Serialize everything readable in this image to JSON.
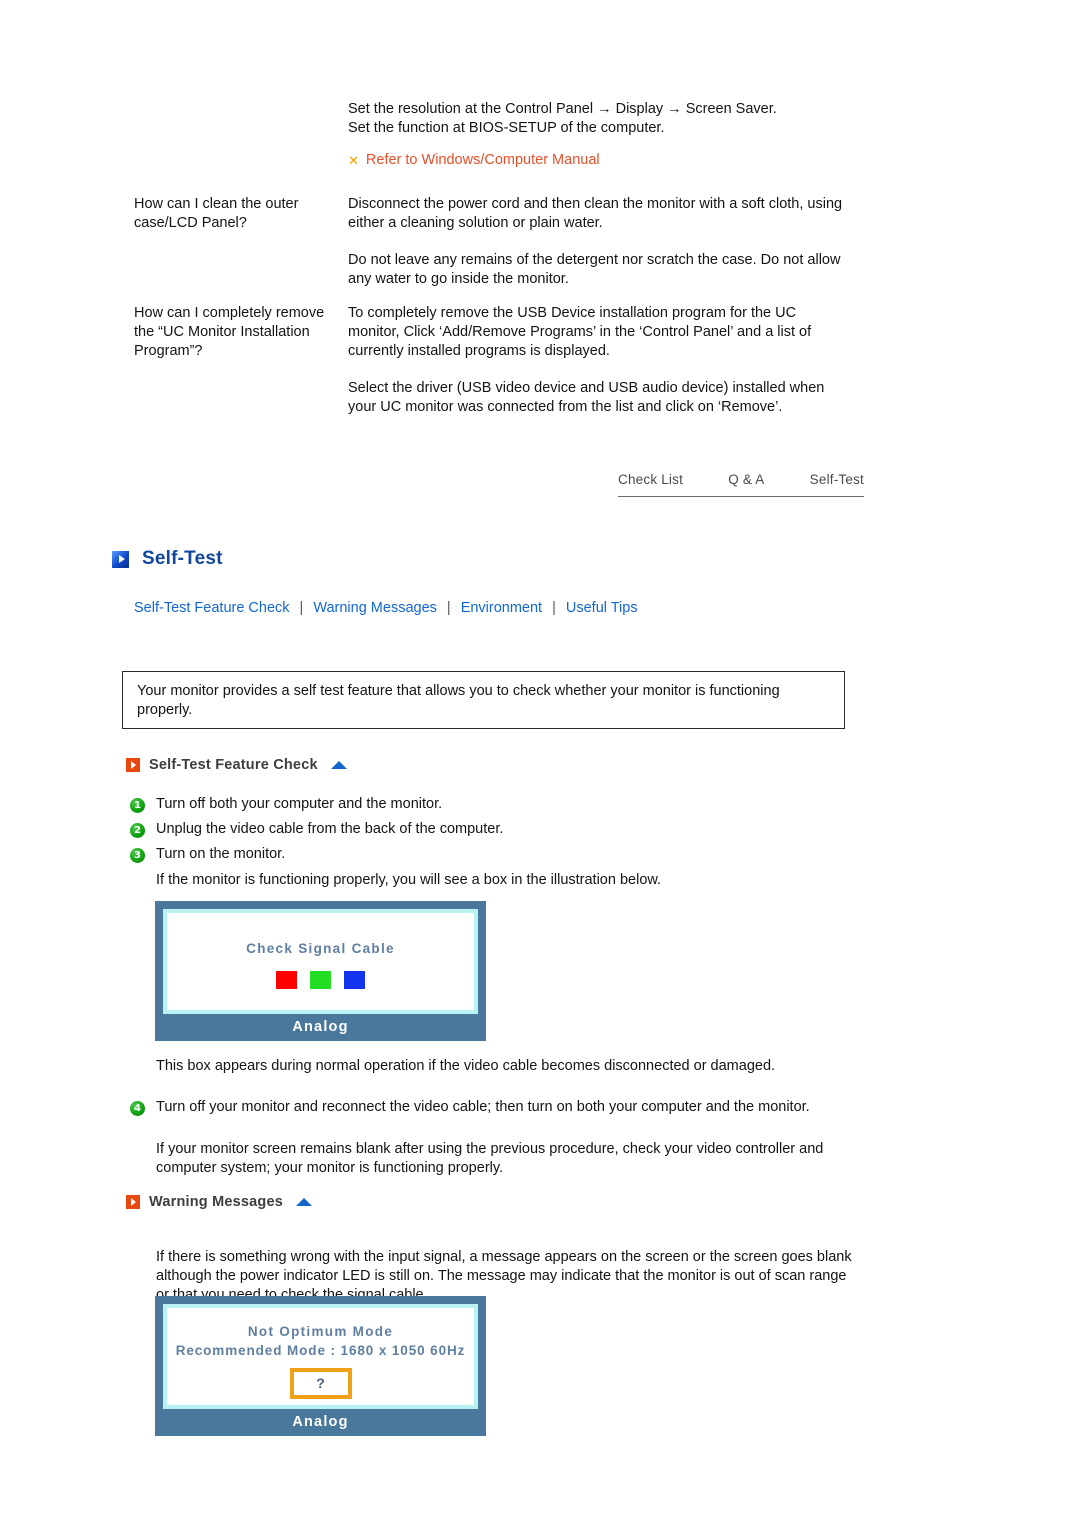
{
  "faq": {
    "intro_lines": [
      "Set the resolution at the Control Panel → Display → Screen Saver.",
      "Set the function at BIOS-SETUP of the computer."
    ],
    "refer_mark": "✕",
    "refer_text": "Refer to Windows/Computer Manual",
    "rows": [
      {
        "question": "How can I clean the outer case/LCD Panel?",
        "answers": [
          "Disconnect the power cord and then clean the monitor with a soft cloth, using either a cleaning solution or plain water.",
          "Do not leave any remains of the detergent nor scratch the case. Do not allow any water to go inside the monitor."
        ]
      },
      {
        "question": "How can I completely remove the “UC Monitor Installation Program”?",
        "answers": [
          "To completely remove the USB Device installation program for the UC monitor, Click ‘Add/Remove Programs’ in the ‘Control Panel’ and a list of currently installed programs is displayed.",
          "Select the driver (USB video device and USB audio device) installed when your UC monitor was connected from the list and click on ‘Remove’."
        ]
      }
    ]
  },
  "tabnav": {
    "tabs": [
      {
        "label": "Check List"
      },
      {
        "label": "Q & A"
      },
      {
        "label": "Self-Test"
      }
    ]
  },
  "section": {
    "title": "Self-Test",
    "icon": "blue-play-square-icon",
    "links": [
      {
        "label": "Self-Test Feature Check"
      },
      {
        "label": "Warning Messages"
      },
      {
        "label": "Environment"
      },
      {
        "label": "Useful Tips"
      }
    ],
    "link_separator": "|"
  },
  "intro_box": {
    "text": "Your monitor provides a self test feature that allows you to check whether your monitor is functioning properly."
  },
  "self_test_feature_check": {
    "heading": "Self-Test Feature Check",
    "steps": [
      {
        "num": "1",
        "text": "Turn off both your computer and the monitor."
      },
      {
        "num": "2",
        "text": "Unplug the video cable from the back of the computer."
      },
      {
        "num": "3",
        "text": "Turn on the monitor."
      }
    ],
    "note_after_steps": "If the monitor is functioning properly, you will see a box in the illustration below.",
    "caption_after_image": "This box appears during normal operation if the video cable becomes disconnected or damaged.",
    "step4": {
      "num": "4",
      "text": "Turn off your monitor and reconnect the video cable; then turn on both your computer and the monitor."
    },
    "closing_note": "If your monitor screen remains blank after using the previous procedure, check your video controller and computer system; your monitor is functioning properly."
  },
  "monitor_check_signal": {
    "osd_title": "Check Signal Cable",
    "analog_label": "Analog",
    "colors": [
      {
        "name": "red-swatch",
        "hex": "#ff0000"
      },
      {
        "name": "green-swatch",
        "hex": "#22dd22"
      },
      {
        "name": "blue-swatch",
        "hex": "#1133ee"
      }
    ],
    "frame_color": "#49789c",
    "bezel_color": "#b9f2f2"
  },
  "warning_messages": {
    "heading": "Warning Messages",
    "body": "If there is something wrong with the input signal, a message appears on the screen or the screen goes blank although the power indicator LED is still on. The message may indicate that the monitor is out of scan range or that you need to check the signal cable."
  },
  "monitor_not_optimum": {
    "osd_line1": "Not Optimum Mode",
    "osd_line2": "Recommended Mode :  1680 x 1050  60Hz",
    "qmark": "?",
    "qmark_border_color": "#f0a11a",
    "analog_label": "Analog"
  }
}
